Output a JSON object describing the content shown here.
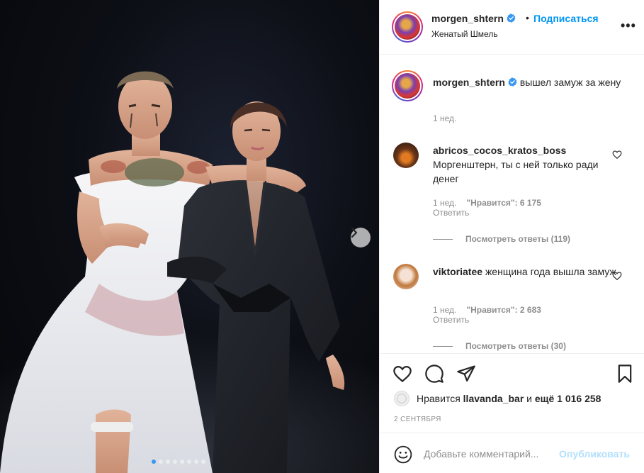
{
  "post": {
    "username": "morgen_shtern",
    "follow_label": "Подписаться",
    "separator": "•",
    "location": "Женатый Шмель",
    "more_label": "•••",
    "caption": "вышел замуж за жену",
    "caption_time": "1 нед.",
    "carousel": {
      "slides": 8,
      "active": 0
    }
  },
  "comments": [
    {
      "username": "abricos_cocos_kratos_boss",
      "text": "Моргенштерн, ты с ней только ради денег",
      "time": "1 нед.",
      "likes": "\"Нравится\": 6 175",
      "reply_label": "Ответить",
      "view_replies": "Посмотреть ответы (119)"
    },
    {
      "username": "viktoriatee",
      "text": "женщина года вышла замуж",
      "time": "1 нед.",
      "likes": "\"Нравится\": 2 683",
      "reply_label": "Ответить",
      "view_replies": "Посмотреть ответы (30)"
    }
  ],
  "actions": {
    "likes_prefix": "Нравится",
    "likes_user": "llavanda_bar",
    "likes_and": "и",
    "likes_rest": "ещё 1 016 258",
    "date": "2 СЕНТЯБРЯ"
  },
  "add_comment": {
    "placeholder": "Добавьте комментарий...",
    "publish_label": "Опубликовать"
  },
  "colors": {
    "accent": "#0095f6",
    "verified": "#3897f0",
    "publish_disabled": "#b2dffc",
    "muted": "#8e8e8e"
  },
  "icons": [
    "chevron-right-icon",
    "verified-icon",
    "heart-icon",
    "comment-icon",
    "share-icon",
    "bookmark-icon",
    "emoji-icon"
  ]
}
